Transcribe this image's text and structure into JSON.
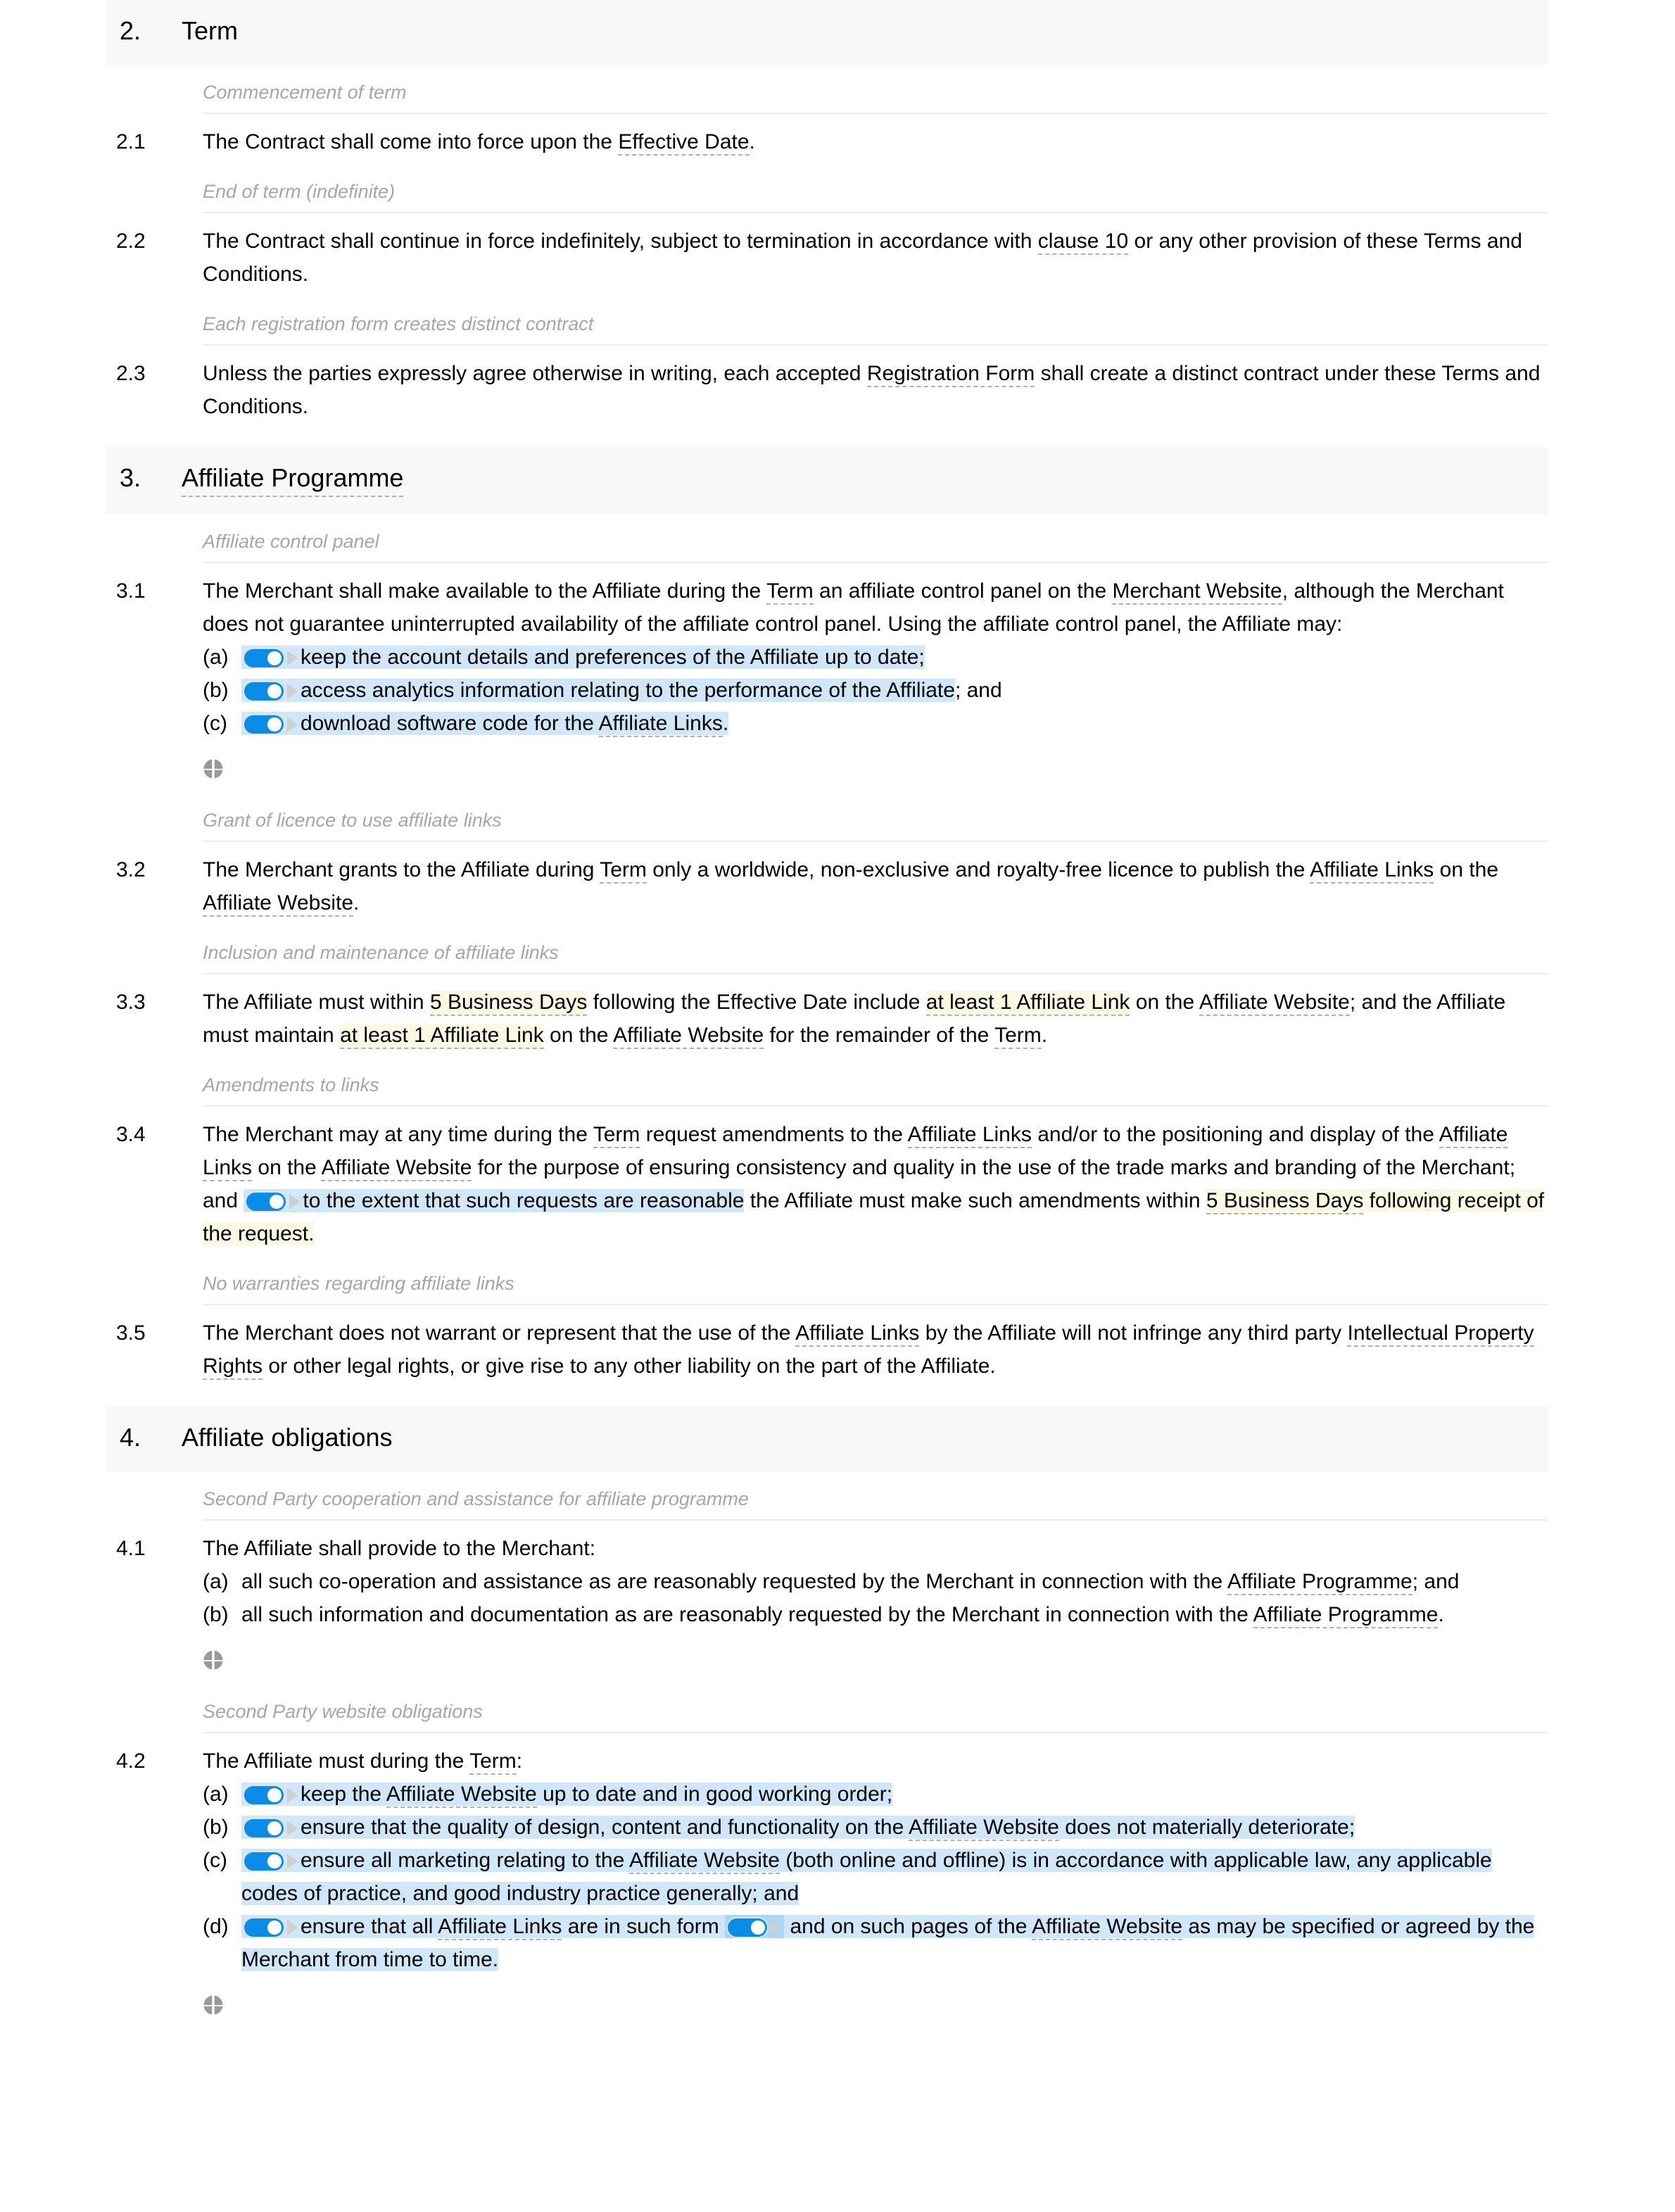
{
  "document": {
    "sections": [
      {
        "number": "2.",
        "title": "Term",
        "title_is_defined_term": false
      },
      {
        "number": "3.",
        "title": "Affiliate Programme",
        "title_is_defined_term": true
      },
      {
        "number": "4.",
        "title": "Affiliate obligations",
        "title_is_defined_term": false
      }
    ],
    "subheadings": {
      "commencement": "Commencement of term",
      "end_of_term": "End of term (indefinite)",
      "each_registration": "Each registration form creates distinct contract",
      "affiliate_control_panel": "Affiliate control panel",
      "grant_of_licence": "Grant of licence to use affiliate links",
      "inclusion_maintenance": "Inclusion and maintenance of affiliate links",
      "amendments_to_links": "Amendments to links",
      "no_warranties": "No warranties regarding affiliate links",
      "second_party_cooperation": "Second Party cooperation and assistance for affiliate programme",
      "second_party_website": "Second Party website obligations"
    },
    "clauses": {
      "c21": {
        "num": "2.1",
        "t1": "The Contract shall come into force upon the ",
        "term1": "Effective Date",
        "t2": "."
      },
      "c22": {
        "num": "2.2",
        "t1": "The Contract shall continue in force indefinitely, subject to termination in accordance with ",
        "term1": "clause 10",
        "t2": " or any other provision of these Terms and Conditions."
      },
      "c23": {
        "num": "2.3",
        "t1": "Unless the parties expressly agree otherwise in writing, each accepted ",
        "term1": "Registration Form",
        "t2": " shall create a distinct contract under these Terms and Conditions."
      },
      "c31": {
        "num": "3.1",
        "t1": "The Merchant shall make available to the Affiliate during the ",
        "term1": "Term",
        "t2": " an affiliate control panel on the ",
        "term2": "Merchant Website",
        "t3": ", although the Merchant does not guarantee uninterrupted availability of the affiliate control panel. Using the affiliate control panel, the Affiliate may:",
        "items": [
          {
            "letter": "(a)",
            "toggle": true,
            "t1": "keep the account details and preferences of the Affiliate up to date;"
          },
          {
            "letter": "(b)",
            "toggle": true,
            "t1": "access analytics information relating to the performance of the Affiliate",
            "t2": "; and"
          },
          {
            "letter": "(c)",
            "toggle": true,
            "t1": "download software code for the ",
            "term1": "Affiliate Links",
            "t2": "."
          }
        ]
      },
      "c32": {
        "num": "3.2",
        "t1": "The Merchant grants to the Affiliate during ",
        "term1": "Term",
        "t2": " only a worldwide, non-exclusive and royalty-free licence to publish the ",
        "term2": "Affiliate Links",
        "t3": " on the ",
        "term3": "Affiliate Website",
        "t4": "."
      },
      "c33": {
        "num": "3.3",
        "t1": "The Affiliate must within ",
        "var1": "5 Business Days",
        "t2": " following the Effective Date include ",
        "var2": "at least 1 Affiliate Link",
        "t3": " on the ",
        "term1": "Affiliate Website",
        "t4": "; and the Affiliate must maintain ",
        "var3": "at least 1 Affiliate Link",
        "t5": " on the ",
        "term2": "Affiliate Website",
        "t6": " for the remainder of the ",
        "term3": "Term",
        "t7": "."
      },
      "c34": {
        "num": "3.4",
        "t1": "The Merchant may at any time during the ",
        "term1": "Term",
        "t2": " request amendments to the ",
        "term2": "Affiliate Links",
        "t3": " and/or to the positioning and display of the ",
        "term3": "Affiliate Links",
        "t4": " on the ",
        "term4": "Affiliate Website",
        "t5": " for the purpose of ensuring consistency and quality in the use of the trade marks and branding of the Merchant; and ",
        "opt_text": "to the extent that such requests are reasonable",
        "t6": " the Affiliate must make such amendments within ",
        "var1": "5 Business Days",
        "t7": " following receipt of the request."
      },
      "c35": {
        "num": "3.5",
        "t1": "The Merchant does not warrant or represent that the use of the ",
        "term1": "Affiliate Links",
        "t2": " by the Affiliate will not infringe any third party ",
        "term2": "Intellectual Property Rights",
        "t3": " or other legal rights, or give rise to any other liability on the part of the Affiliate."
      },
      "c41": {
        "num": "4.1",
        "t1": "The Affiliate shall provide to the Merchant:",
        "items": [
          {
            "letter": "(a)",
            "t1": "all such co-operation and assistance as are reasonably requested by the Merchant in connection with the ",
            "term1": "Affiliate Programme",
            "t2": "; and"
          },
          {
            "letter": "(b)",
            "t1": "all such information and documentation as are reasonably requested by the Merchant in connection with the ",
            "term1": "Affiliate Programme",
            "t2": "."
          }
        ]
      },
      "c42": {
        "num": "4.2",
        "t1": "The Affiliate must during the ",
        "term1": "Term",
        "t2": ":",
        "items": [
          {
            "letter": "(a)",
            "toggle": true,
            "t1": "keep the ",
            "term1": "Affiliate Website",
            "t2": " up to date and in good working order;"
          },
          {
            "letter": "(b)",
            "toggle": true,
            "t1": "ensure that the quality of design, content and functionality on the ",
            "term1": "Affiliate Website",
            "t2": " does not materially deteriorate;"
          },
          {
            "letter": "(c)",
            "toggle": true,
            "t1": "ensure all marketing relating to the ",
            "term1": "Affiliate Website",
            "t2": " (both online and offline) is in accordance with applicable law, any applicable codes of practice, and good industry practice generally; and"
          },
          {
            "letter": "(d)",
            "toggle": true,
            "t1": "ensure that all ",
            "term1": "Affiliate Links",
            "t2": " are in such form ",
            "inner_toggle": true,
            "t3": " and on such pages of the ",
            "term2": "Affiliate Website",
            "t4": " as may be specified or agreed by the Merchant from time to time."
          }
        ]
      }
    },
    "icons": {
      "drag_handle": "drag-handle-icon",
      "toggle_on": "toggle-on-icon",
      "marker_triangle": "triangle-marker-icon"
    },
    "colors": {
      "toggle_on": "#0a8ce8",
      "optional_highlight": "#cfe7f8",
      "optional_highlight_nested": "#a9d7f5",
      "variable_highlight": "#fbf8e3",
      "section_bar": "#f8f8f8",
      "subheading_text": "#a6a6a6",
      "rule": "#ececec"
    }
  }
}
